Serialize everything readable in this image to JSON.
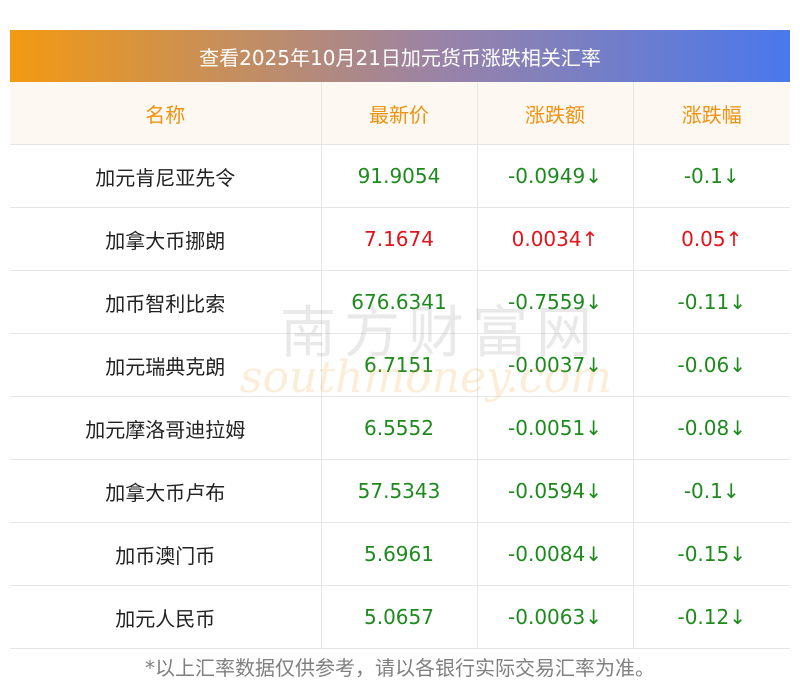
{
  "title": "查看2025年10月21日加元货币涨跌相关汇率",
  "headers": [
    "名称",
    "最新价",
    "涨跌额",
    "涨跌幅"
  ],
  "rows": [
    {
      "name": "加元肯尼亚先令",
      "price": "91.9054",
      "change": "-0.0949",
      "pct": "-0.1",
      "dir": "down",
      "arrow": "↓"
    },
    {
      "name": "加拿大币挪朗",
      "price": "7.1674",
      "change": "0.0034",
      "pct": "0.05",
      "dir": "up",
      "arrow": "↑"
    },
    {
      "name": "加币智利比索",
      "price": "676.6341",
      "change": "-0.7559",
      "pct": "-0.11",
      "dir": "down",
      "arrow": "↓"
    },
    {
      "name": "加元瑞典克朗",
      "price": "6.7151",
      "change": "-0.0037",
      "pct": "-0.06",
      "dir": "down",
      "arrow": "↓"
    },
    {
      "name": "加元摩洛哥迪拉姆",
      "price": "6.5552",
      "change": "-0.0051",
      "pct": "-0.08",
      "dir": "down",
      "arrow": "↓"
    },
    {
      "name": "加拿大币卢布",
      "price": "57.5343",
      "change": "-0.0594",
      "pct": "-0.1",
      "dir": "down",
      "arrow": "↓"
    },
    {
      "name": "加币澳门币",
      "price": "5.6961",
      "change": "-0.0084",
      "pct": "-0.15",
      "dir": "down",
      "arrow": "↓"
    },
    {
      "name": "加元人民币",
      "price": "5.0657",
      "change": "-0.0063",
      "pct": "-0.12",
      "dir": "down",
      "arrow": "↓"
    }
  ],
  "note": "*以上汇率数据仅供参考，请以各银行实际交易汇率为准。",
  "watermark": {
    "cn": "南方财富网",
    "en": "southmoney.com"
  },
  "colors": {
    "header_text": "#f0920f",
    "up": "#e0141a",
    "down": "#1e8a1e",
    "title_from": "#f39a11",
    "title_to": "#4a78ec"
  }
}
